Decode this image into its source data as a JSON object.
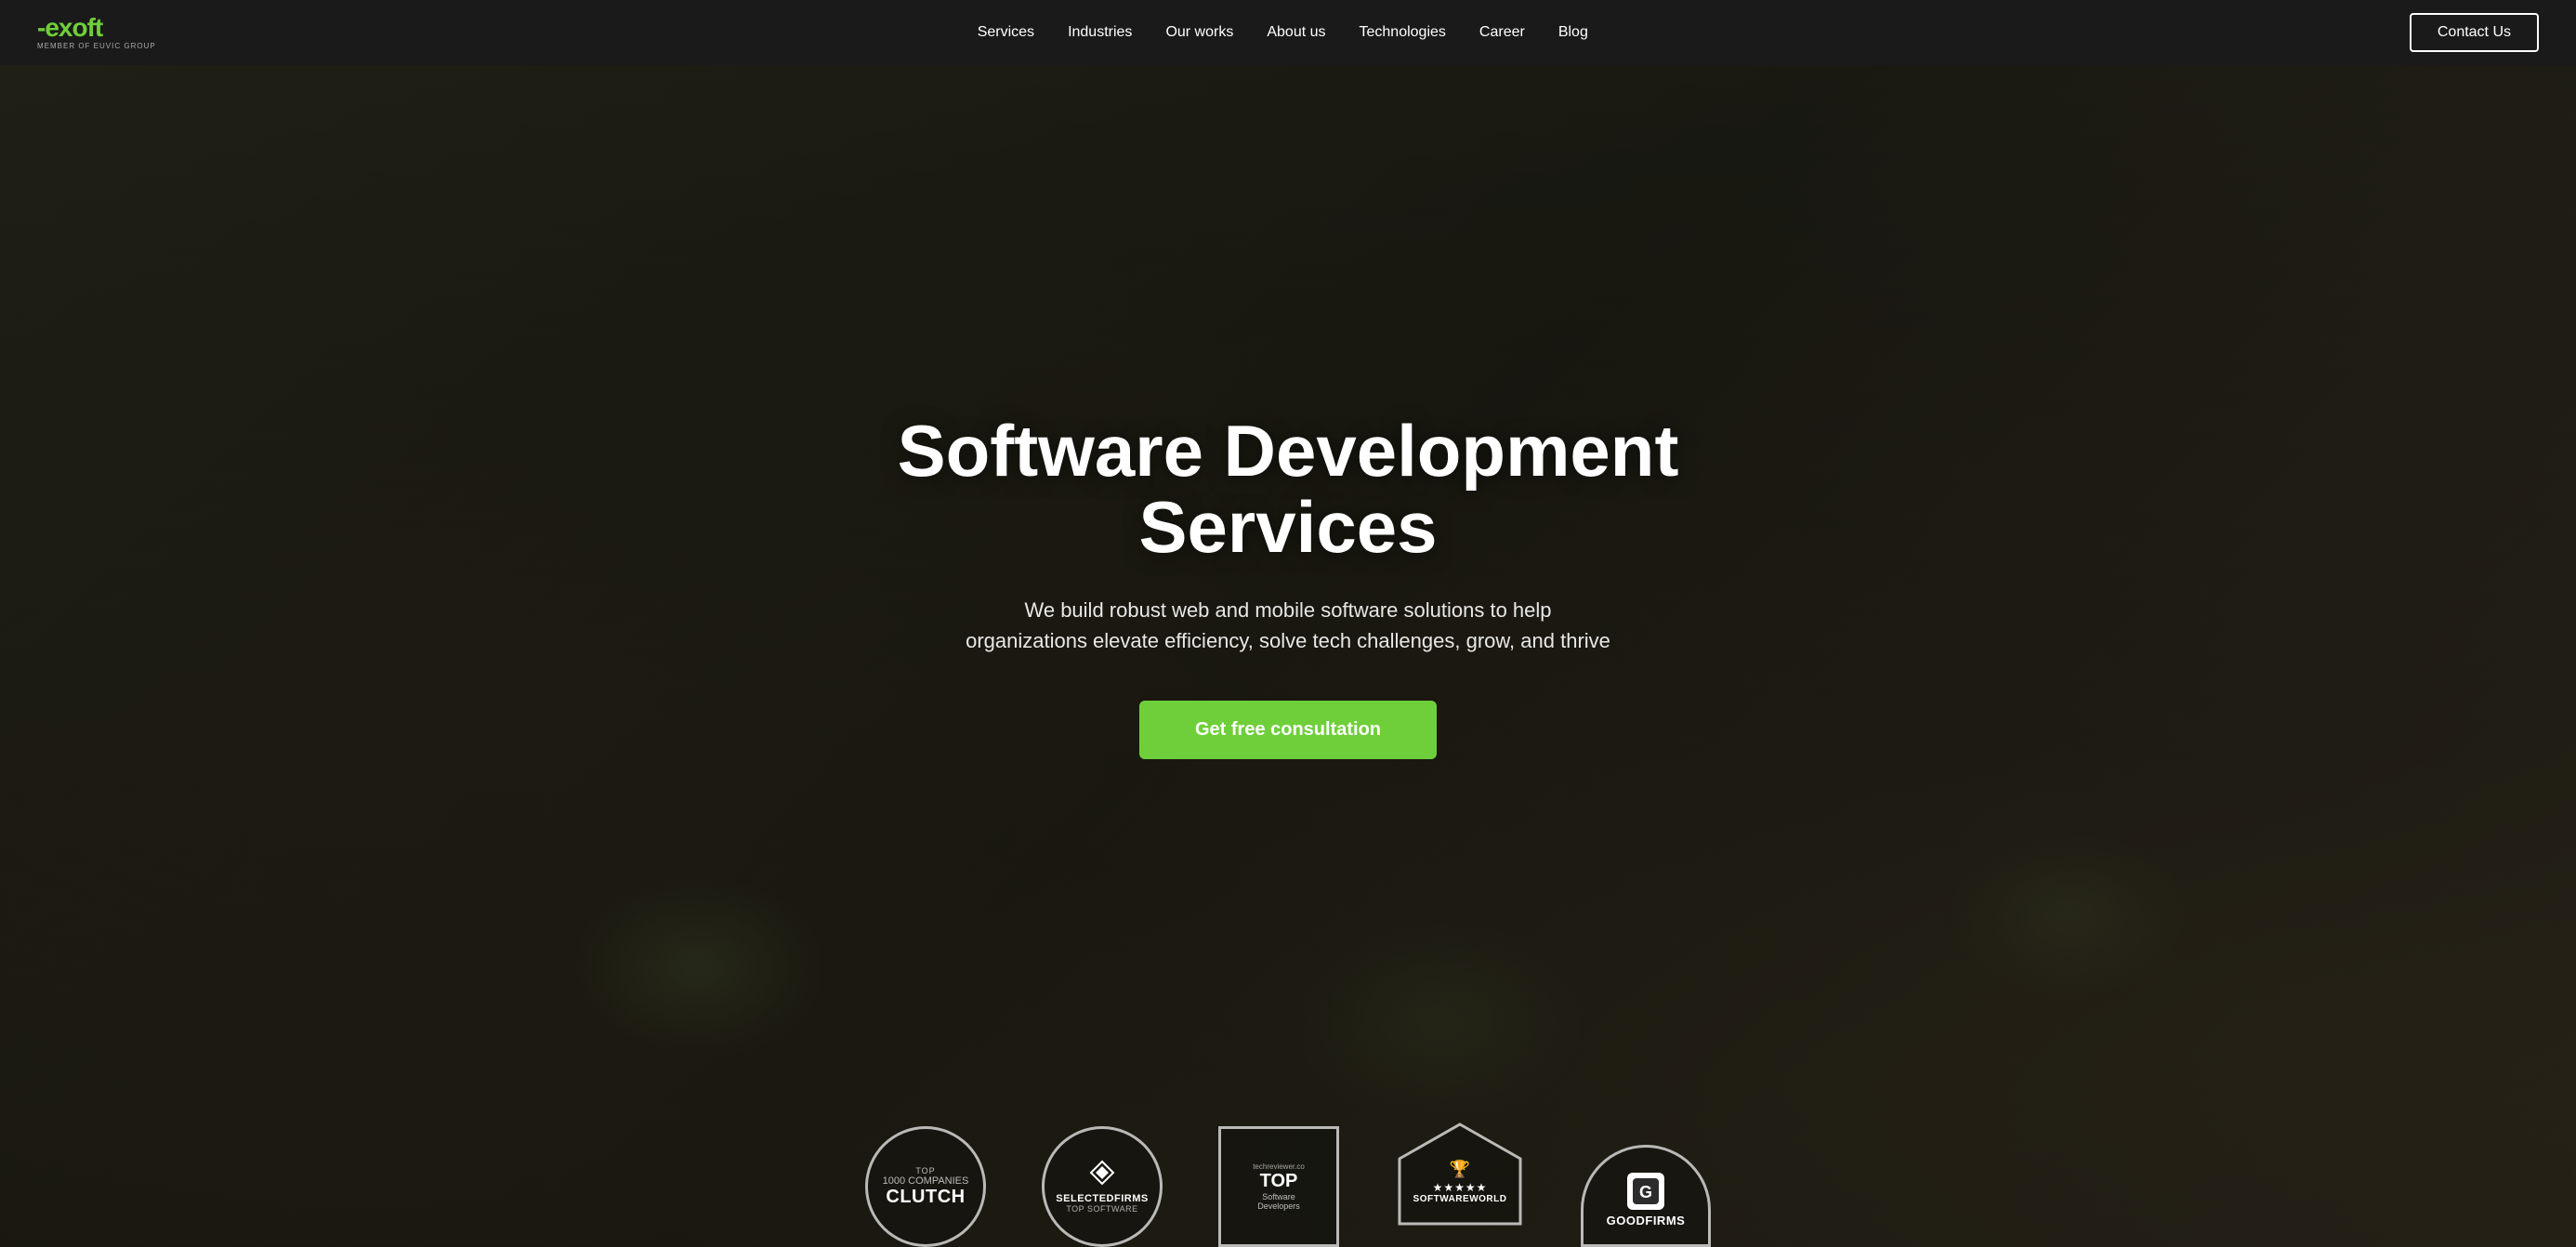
{
  "navbar": {
    "logo": {
      "prefix": "-",
      "brand": "exoft",
      "sub": "MEMBER OF EUVIC GROUP"
    },
    "links": [
      {
        "id": "services",
        "label": "Services"
      },
      {
        "id": "industries",
        "label": "Industries"
      },
      {
        "id": "our-works",
        "label": "Our works"
      },
      {
        "id": "about-us",
        "label": "About us"
      },
      {
        "id": "technologies",
        "label": "Technologies"
      },
      {
        "id": "career",
        "label": "Career"
      },
      {
        "id": "blog",
        "label": "Blog"
      }
    ],
    "cta_label": "Contact Us"
  },
  "hero": {
    "title": "Software Development Services",
    "subtitle": "We build robust web and mobile software solutions to help organizations elevate efficiency, solve tech challenges, grow, and thrive",
    "cta_label": "Get free consultation"
  },
  "badges": [
    {
      "id": "clutch",
      "shape": "circle",
      "top": "TOP",
      "number": "1000 COMPANIES",
      "main": "Clutch",
      "sub": ""
    },
    {
      "id": "selectedfirms",
      "shape": "circle",
      "icon": "SF",
      "top": "",
      "main": "SelectedFirms",
      "sub": "TOP SOFTWARE"
    },
    {
      "id": "techreviewer",
      "shape": "rect",
      "source": "techreviewer.co",
      "rank": "TOP",
      "main": "Software",
      "sub": "Developers"
    },
    {
      "id": "softwareworld",
      "shape": "pentagon",
      "stars": "★★★★★",
      "main": "SOFTWAREWORLD",
      "sub": ""
    },
    {
      "id": "goodfirms",
      "shape": "halfcircle",
      "icon": "G",
      "main": "GoodFirms",
      "sub": ""
    }
  ]
}
